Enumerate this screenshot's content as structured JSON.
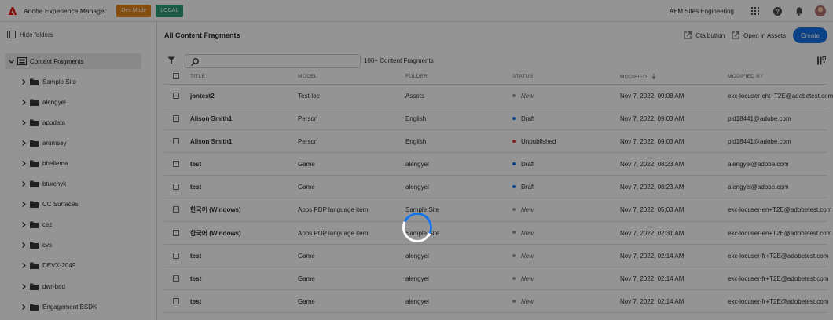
{
  "topbar": {
    "app_title": "Adobe Experience Manager",
    "badge_dev": "Dev Mode",
    "badge_local": "LOCAL",
    "org_name": "AEM Sites Engineering"
  },
  "sidebar": {
    "hide_folders_label": "Hide folders",
    "root_label": "Content Fragments",
    "items": [
      {
        "label": "Sample Site"
      },
      {
        "label": "alengyel"
      },
      {
        "label": "appdata"
      },
      {
        "label": "arumsey"
      },
      {
        "label": "bhellema"
      },
      {
        "label": "bturchyk"
      },
      {
        "label": "CC Surfaces"
      },
      {
        "label": "cez"
      },
      {
        "label": "cvs"
      },
      {
        "label": "DEVX-2049"
      },
      {
        "label": "dwr-bad"
      },
      {
        "label": "Engagement ESDK"
      }
    ]
  },
  "main": {
    "title": "All Content Fragments",
    "cta_button_label": "Cta button",
    "open_in_assets_label": "Open in Assets",
    "create_label": "Create",
    "count_label": "100+ Content Fragments",
    "columns": {
      "title": "TITLE",
      "model": "MODEL",
      "folder": "FOLDER",
      "status": "STATUS",
      "modified": "MODIFIED",
      "modified_by": "MODIFIED BY"
    },
    "rows": [
      {
        "title": "jontest2",
        "model": "Test-loc",
        "folder": "Assets",
        "status": "New",
        "modified": "Nov 7, 2022, 09:08 AM",
        "modified_by": "exc-locuser-cht+T2E@adobetest.com"
      },
      {
        "title": "Alison Smith1",
        "model": "Person",
        "folder": "English",
        "status": "Draft",
        "modified": "Nov 7, 2022, 09:03 AM",
        "modified_by": "pid18441@adobe.com"
      },
      {
        "title": "Alison Smith1",
        "model": "Person",
        "folder": "English",
        "status": "Unpublished",
        "modified": "Nov 7, 2022, 09:03 AM",
        "modified_by": "pid18441@adobe.com"
      },
      {
        "title": "test",
        "model": "Game",
        "folder": "alengyel",
        "status": "Draft",
        "modified": "Nov 7, 2022, 08:23 AM",
        "modified_by": "alengyel@adobe.com"
      },
      {
        "title": "test",
        "model": "Game",
        "folder": "alengyel",
        "status": "Draft",
        "modified": "Nov 7, 2022, 08:23 AM",
        "modified_by": "alengyel@adobe.com"
      },
      {
        "title": "한국어 (Windows)",
        "model": "Apps PDP language item",
        "folder": "Sample Site",
        "status": "New",
        "modified": "Nov 7, 2022, 05:03 AM",
        "modified_by": "exc-locuser-en+T2E@adobetest.com"
      },
      {
        "title": "한국어 (Windows)",
        "model": "Apps PDP language item",
        "folder": "Sample Site",
        "status": "New",
        "modified": "Nov 7, 2022, 02:31 AM",
        "modified_by": "exc-locuser-en+T2E@adobetest.com"
      },
      {
        "title": "test",
        "model": "Game",
        "folder": "alengyel",
        "status": "New",
        "modified": "Nov 7, 2022, 02:14 AM",
        "modified_by": "exc-locuser-fr+T2E@adobetest.com"
      },
      {
        "title": "test",
        "model": "Game",
        "folder": "alengyel",
        "status": "New",
        "modified": "Nov 7, 2022, 02:14 AM",
        "modified_by": "exc-locuser-fr+T2E@adobetest.com"
      },
      {
        "title": "test",
        "model": "Game",
        "folder": "alengyel",
        "status": "New",
        "modified": "Nov 7, 2022, 02:14 AM",
        "modified_by": "exc-locuser-fr+T2E@adobetest.com"
      }
    ]
  },
  "colors": {
    "accent": "#1473e6",
    "dev_badge": "#e68619",
    "local_badge": "#2d9d78",
    "status_new": "#9a9a9a",
    "status_draft": "#1473e6",
    "status_unpublished": "#d7373f"
  },
  "overlay": {
    "loading": true
  }
}
